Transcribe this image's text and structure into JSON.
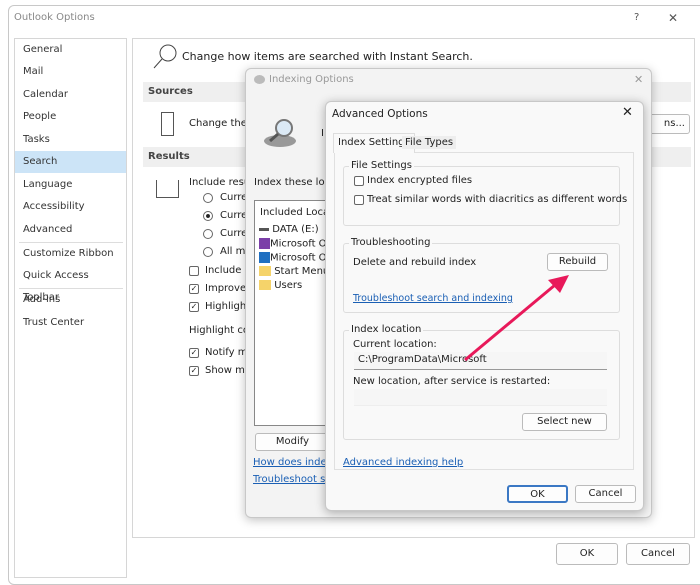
{
  "outlook": {
    "title": "Outlook Options",
    "help": "?",
    "close": "✕",
    "nav": [
      "General",
      "Mail",
      "Calendar",
      "People",
      "Tasks",
      "Search",
      "Language",
      "Accessibility",
      "Advanced",
      "Customize Ribbon",
      "Quick Access Toolbar",
      "Add-ins",
      "Trust Center"
    ],
    "header": "Change how items are searched with Instant Search.",
    "sources_title": "Sources",
    "sources_text": "Change the O",
    "indexing_button": "ns...",
    "results_title": "Results",
    "include_results": "Include resul",
    "radios": [
      "Curre",
      "Curre",
      "Curre",
      "All ma"
    ],
    "checks": [
      {
        "label": "Include m",
        "checked": false
      },
      {
        "label": "Improve",
        "checked": true
      },
      {
        "label": "Highlight",
        "checked": true
      }
    ],
    "highlight_color": "Highlight co",
    "checks2": [
      {
        "label": "Notify m",
        "checked": true
      },
      {
        "label": "Show mo",
        "checked": true
      }
    ],
    "ok": "OK",
    "cancel": "Cancel"
  },
  "indexing": {
    "title": "Indexing Options",
    "close": "✕",
    "index_these": "Index these locati",
    "letter": "I",
    "list_header": "Included Locatio",
    "locations": [
      "DATA (E:)",
      "Microsoft On",
      "Microsoft Ou",
      "Start Menu",
      "Users"
    ],
    "modify": "Modify",
    "link1": "How does indexing",
    "link2": "Troubleshoot sear"
  },
  "advanced": {
    "title": "Advanced Options",
    "close": "✕",
    "tabs": [
      "Index Settings",
      "File Types"
    ],
    "file_settings": "File Settings",
    "cb1": "Index encrypted files",
    "cb2": "Treat similar words with diacritics as different words",
    "troubleshooting": "Troubleshooting",
    "delete_rebuild": "Delete and rebuild index",
    "rebuild": "Rebuild",
    "troubleshoot_link": "Troubleshoot search and indexing",
    "index_location": "Index location",
    "current_location_label": "Current location:",
    "current_location": "C:\\ProgramData\\Microsoft",
    "new_location_label": "New location, after service is restarted:",
    "new_location": "",
    "select_new": "Select new",
    "help_link": "Advanced indexing help",
    "ok": "OK",
    "cancel": "Cancel"
  },
  "colors": {
    "arrow": "#e8195a",
    "selected": "#cce4f7",
    "link": "#1a5fb4"
  }
}
